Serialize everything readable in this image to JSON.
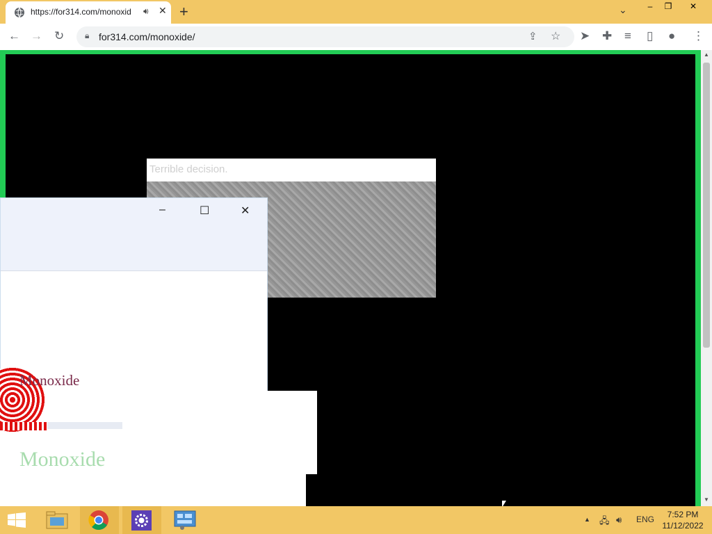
{
  "browser": {
    "tab_title": "https://for314.com/monoxid",
    "tab_close": "✕",
    "new_tab": "+",
    "tab_search": "⌄",
    "window_controls": {
      "minimize": "‒",
      "maximize": "❐",
      "close": "✕"
    },
    "address": "for314.com/monoxide/",
    "icons": {
      "back": "arrow-left-icon",
      "forward": "arrow-right-icon",
      "reload": "reload-icon",
      "lock": "lock-icon",
      "share": "share-icon",
      "star": "star-icon",
      "extension_arrow": "cursor-arrow-icon",
      "extensions": "puzzle-icon",
      "media": "media-icon",
      "sidepanel": "side-panel-icon",
      "profile": "profile-icon",
      "menu": "kebab-icon"
    }
  },
  "dialog": {
    "title": "Terrible decision."
  },
  "ghost_windows": {
    "controls": {
      "minimize": "–",
      "maximize": "☐",
      "close": "✕"
    },
    "label_1": "Monoxide",
    "label_2": "Monoxide"
  },
  "taskbar": {
    "language": "ENG",
    "time": "7:52 PM",
    "date": "11/12/2022",
    "apps": [
      "start",
      "file-explorer",
      "chrome",
      "settings",
      "control-panel"
    ]
  },
  "colors": {
    "taskbar": "#f2c765",
    "page_border": "#22cc55",
    "accent_red": "#e01010"
  }
}
